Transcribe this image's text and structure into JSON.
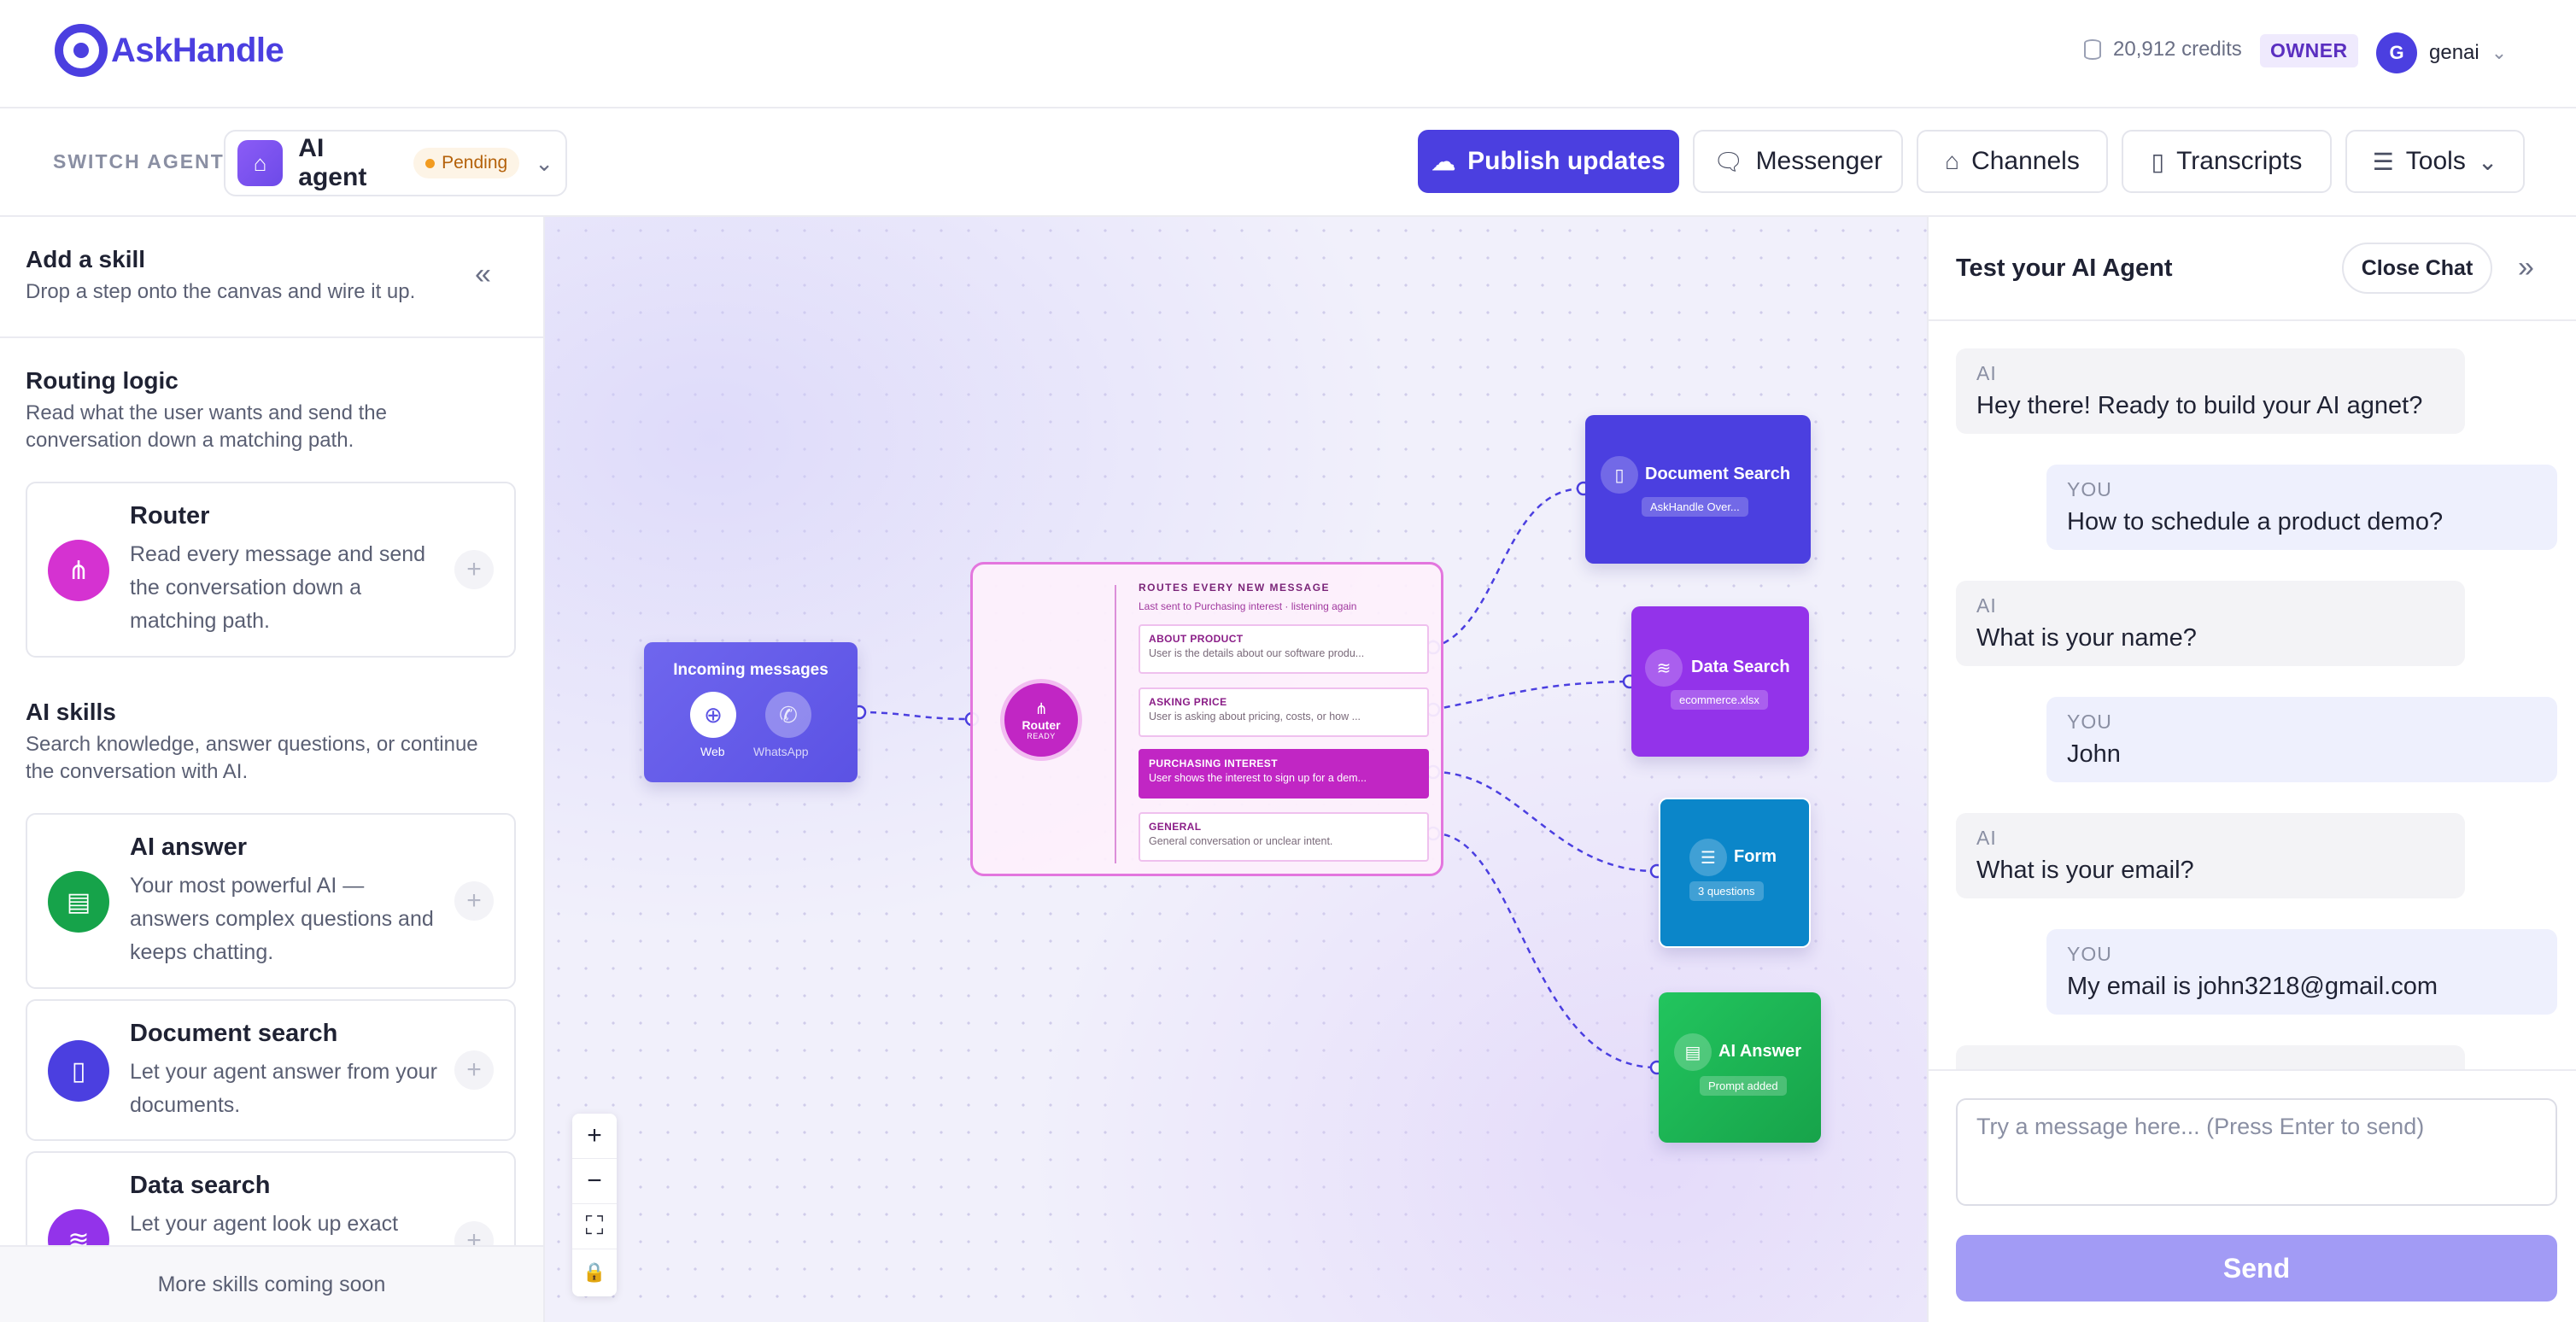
{
  "brand": {
    "name": "AskHandle"
  },
  "account": {
    "credits": "20,912 credits",
    "role": "OWNER",
    "avatar_initial": "G",
    "username": "genai"
  },
  "agent_bar": {
    "switch_label": "SWITCH AGENT",
    "agent_name": "AI agent",
    "status": "Pending",
    "buttons": {
      "publish": "Publish updates",
      "messenger": "Messenger",
      "channels": "Channels",
      "transcripts": "Transcripts",
      "tools": "Tools"
    }
  },
  "left_panel": {
    "title": "Add a skill",
    "subtitle": "Drop a step onto the canvas and wire it up.",
    "routing": {
      "title": "Routing logic",
      "desc": "Read what the user wants and send the conversation down a matching path.",
      "router": {
        "title": "Router",
        "desc": "Read every message and send the conversation down a matching path."
      }
    },
    "ai_skills": {
      "title": "AI skills",
      "desc": "Search knowledge, answer questions, or continue the conversation with AI.",
      "items": [
        {
          "title": "AI answer",
          "desc": "Your most powerful AI — answers complex questions and keeps chatting.",
          "color": "#16a34a"
        },
        {
          "title": "Document search",
          "desc": "Let your agent answer from your documents.",
          "color": "#4b3fe0"
        },
        {
          "title": "Data search",
          "desc": "Let your agent look up exact",
          "color": "#9333ea"
        }
      ]
    },
    "footer": "More skills coming soon"
  },
  "canvas": {
    "incoming": {
      "title": "Incoming messages",
      "channels": [
        "Web",
        "WhatsApp"
      ]
    },
    "router": {
      "label": "Router",
      "state": "READY",
      "header": "ROUTES EVERY NEW MESSAGE",
      "subheader": "Last sent to Purchasing interest · listening again",
      "routes": [
        {
          "title": "ABOUT PRODUCT",
          "desc": "User is the details about our software produ...",
          "active": false
        },
        {
          "title": "ASKING PRICE",
          "desc": "User is asking about pricing, costs, or how ...",
          "active": false
        },
        {
          "title": "PURCHASING INTEREST",
          "desc": "User shows the interest to sign up for a dem...",
          "active": true
        },
        {
          "title": "GENERAL",
          "desc": "General conversation or unclear intent.",
          "active": false
        }
      ]
    },
    "targets": {
      "document_search": {
        "title": "Document Search",
        "badge": "AskHandle Over...",
        "color": "#4b3fe0"
      },
      "data_search": {
        "title": "Data Search",
        "badge": "ecommerce.xlsx",
        "color": "#9333ea"
      },
      "form": {
        "title": "Form",
        "badge": "3 questions",
        "color": "#0b86c9"
      },
      "ai_answer": {
        "title": "AI Answer",
        "badge": "Prompt added",
        "color": "#1fb457"
      }
    }
  },
  "chat": {
    "title": "Test your AI Agent",
    "close_label": "Close Chat",
    "messages": [
      {
        "sender": "AI",
        "text": "Hey there! Ready to build your AI agnet?"
      },
      {
        "sender": "YOU",
        "text": "How to schedule a product demo?"
      },
      {
        "sender": "AI",
        "text": "What is your name?"
      },
      {
        "sender": "YOU",
        "text": "John"
      },
      {
        "sender": "AI",
        "text": "What is your email?"
      },
      {
        "sender": "YOU",
        "text": "My email is john3218@gmail.com"
      }
    ],
    "input_placeholder": "Try a message here... (Press Enter to send)",
    "send_label": "Send"
  }
}
